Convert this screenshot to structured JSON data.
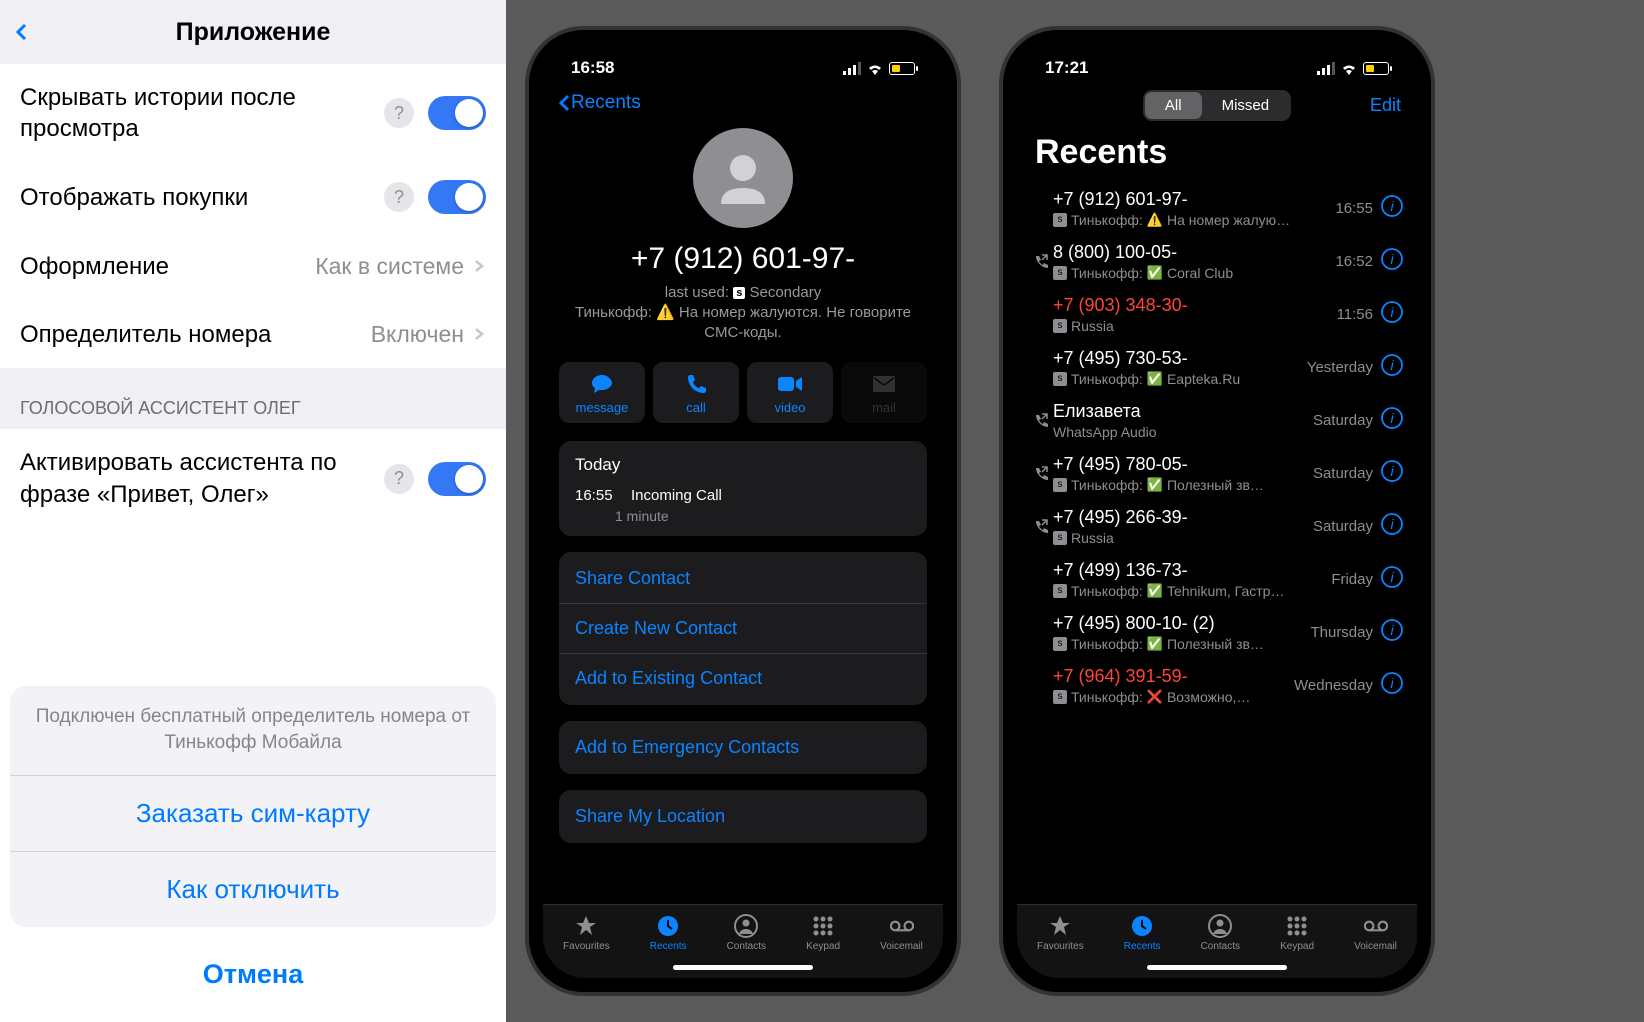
{
  "panel1": {
    "title": "Приложение",
    "rows": {
      "hide_stories": "Скрывать истории после просмотра",
      "show_purchases": "Отображать покупки",
      "appearance_label": "Оформление",
      "appearance_value": "Как в системе",
      "caller_id_label": "Определитель номера",
      "caller_id_value": "Включен"
    },
    "section_header": "ГОЛОСОВОЙ АССИСТЕНТ ОЛЕГ",
    "assistant_row": "Активировать ассистента по фразе «Привет, Олег»",
    "sheet": {
      "message": "Подключен бесплатный определитель номера от Тинькофф Мобайла",
      "btn1": "Заказать сим-карту",
      "btn2": "Как отключить",
      "cancel": "Отмена"
    }
  },
  "panel2": {
    "time": "16:58",
    "back": "Recents",
    "phone": "+7 (912) 601-97-",
    "last_used_prefix": "last used:",
    "last_used_sim": "Secondary",
    "warning": "Тинькофф: ⚠️ На номер жалуются. Не говорите СМС-коды.",
    "actions": {
      "message": "message",
      "call": "call",
      "video": "video",
      "mail": "mail"
    },
    "today": "Today",
    "call_time": "16:55",
    "call_type": "Incoming Call",
    "call_dur": "1 minute",
    "links": {
      "share": "Share Contact",
      "create": "Create New Contact",
      "add_existing": "Add to Existing Contact",
      "emergency": "Add to Emergency Contacts",
      "location": "Share My Location"
    }
  },
  "panel3": {
    "time": "17:21",
    "seg_all": "All",
    "seg_missed": "Missed",
    "edit": "Edit",
    "title": "Recents",
    "rows": [
      {
        "num": "+7 (912) 601-97-",
        "sub": "Тинькофф: ⚠️ На номер жалую…",
        "date": "16:55",
        "missed": false,
        "out": false,
        "sim": true,
        "emoji": "⚠️",
        "subtext": "Тинькофф:",
        "subrest": "На номер жалую…"
      },
      {
        "num": "8 (800) 100-05-",
        "sub": "",
        "date": "16:52",
        "missed": false,
        "out": true,
        "sim": true,
        "emoji": "✅",
        "subtext": "Тинькофф:",
        "subrest": "Coral Club"
      },
      {
        "num": "+7 (903) 348-30-",
        "sub": "Russia",
        "date": "11:56",
        "missed": true,
        "out": false,
        "sim": true,
        "emoji": "",
        "subtext": "",
        "subrest": "Russia"
      },
      {
        "num": "+7 (495) 730-53-",
        "sub": "",
        "date": "Yesterday",
        "missed": false,
        "out": false,
        "sim": true,
        "emoji": "✅",
        "subtext": "Тинькофф:",
        "subrest": "Eapteka.Ru"
      },
      {
        "num": "Елизавета",
        "sub": "WhatsApp Audio",
        "date": "Saturday",
        "missed": false,
        "out": true,
        "sim": false,
        "emoji": "",
        "subtext": "",
        "subrest": "WhatsApp Audio"
      },
      {
        "num": "+7 (495) 780-05-",
        "sub": "",
        "date": "Saturday",
        "missed": false,
        "out": true,
        "sim": true,
        "emoji": "✅",
        "subtext": "Тинькофф:",
        "subrest": "Полезный зв…"
      },
      {
        "num": "+7 (495) 266-39-",
        "sub": "Russia",
        "date": "Saturday",
        "missed": false,
        "out": true,
        "sim": true,
        "emoji": "",
        "subtext": "",
        "subrest": "Russia"
      },
      {
        "num": "+7 (499) 136-73-",
        "sub": "",
        "date": "Friday",
        "missed": false,
        "out": false,
        "sim": true,
        "emoji": "✅",
        "subtext": "Тинькофф:",
        "subrest": "Tehnikum, Гастр…"
      },
      {
        "num": "+7 (495) 800-10-    (2)",
        "sub": "",
        "date": "Thursday",
        "missed": false,
        "out": false,
        "sim": true,
        "emoji": "✅",
        "subtext": "Тинькофф:",
        "subrest": "Полезный зв…"
      },
      {
        "num": "+7 (964) 391-59-",
        "sub": "",
        "date": "Wednesday",
        "missed": true,
        "out": false,
        "sim": true,
        "emoji": "❌",
        "subtext": "Тинькофф:",
        "subrest": "Возможно,…"
      }
    ]
  },
  "tabs": {
    "fav": "Favourites",
    "recents": "Recents",
    "contacts": "Contacts",
    "keypad": "Keypad",
    "voicemail": "Voicemail"
  }
}
